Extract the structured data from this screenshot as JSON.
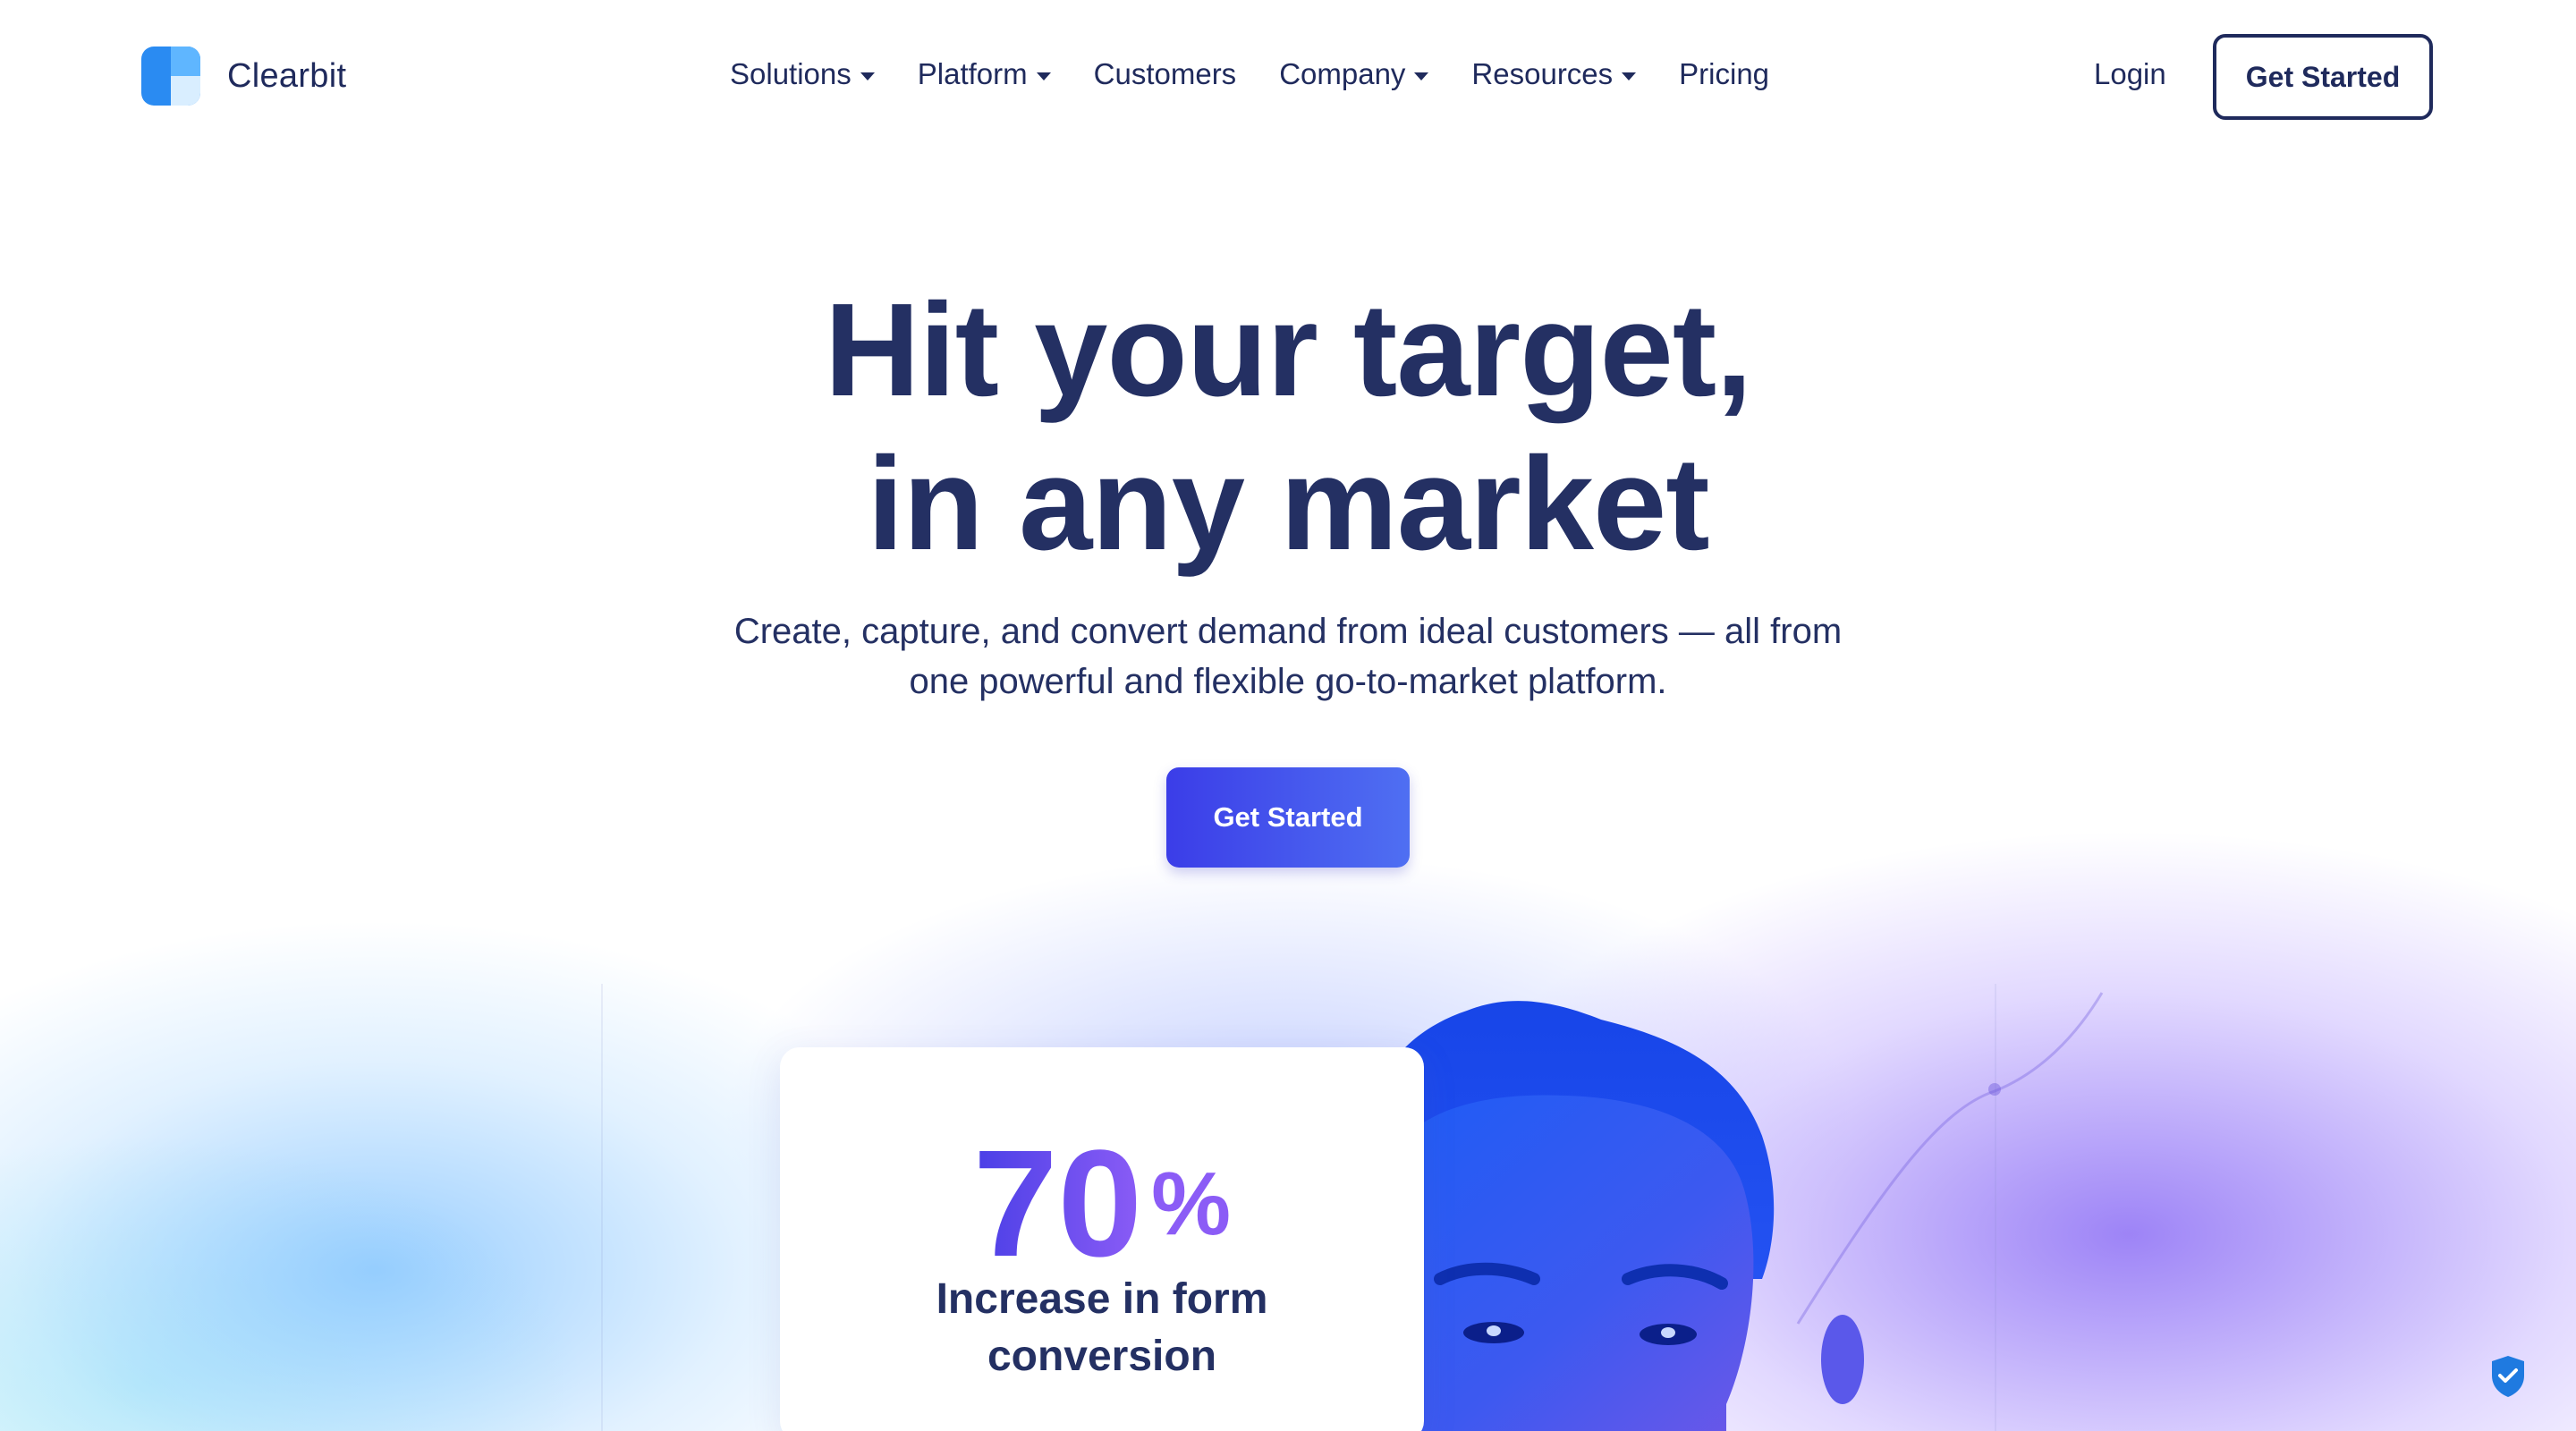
{
  "brand": {
    "name": "Clearbit"
  },
  "nav": {
    "items": [
      {
        "label": "Solutions",
        "has_dropdown": true
      },
      {
        "label": "Platform",
        "has_dropdown": true
      },
      {
        "label": "Customers",
        "has_dropdown": false
      },
      {
        "label": "Company",
        "has_dropdown": true
      },
      {
        "label": "Resources",
        "has_dropdown": true
      },
      {
        "label": "Pricing",
        "has_dropdown": false
      }
    ],
    "login_label": "Login",
    "cta_label": "Get Started"
  },
  "hero": {
    "title_line1": "Hit your target,",
    "title_line2": "in any market",
    "subtitle_line1": "Create, capture, and convert demand from ideal customers — all from",
    "subtitle_line2": "one powerful and flexible go-to-market platform.",
    "cta_label": "Get Started"
  },
  "stat": {
    "value": "70",
    "unit": "%",
    "label_line1": "Increase in form",
    "label_line2": "conversion"
  },
  "icons": {
    "caret": "chevron-down-icon",
    "shield": "shield-check-icon"
  },
  "colors": {
    "text": "#243063",
    "primary": "#3b3de8",
    "accent": "#8b5cf6",
    "logo_blue": "#2a8bf2"
  }
}
